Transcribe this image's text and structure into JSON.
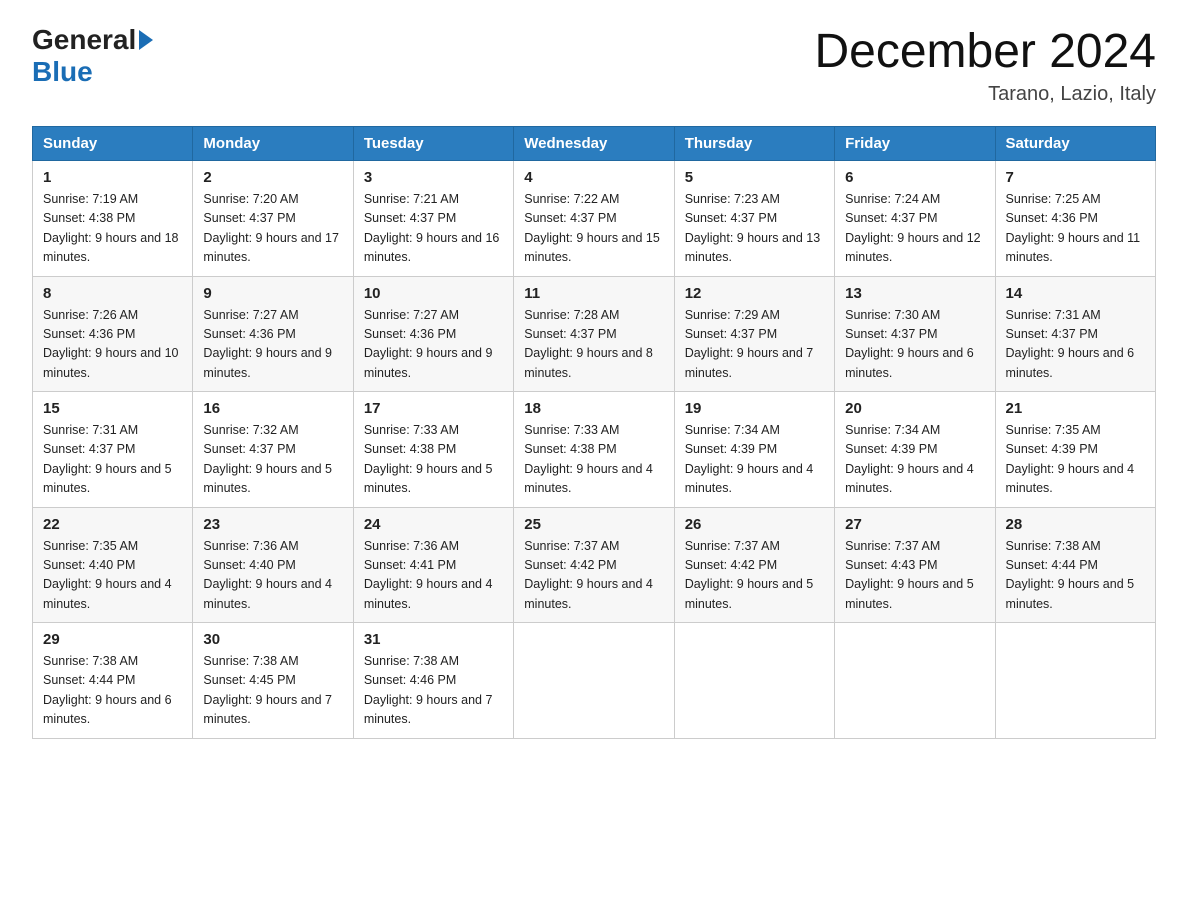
{
  "header": {
    "logo_general": "General",
    "logo_blue": "Blue",
    "title": "December 2024",
    "location": "Tarano, Lazio, Italy"
  },
  "days_of_week": [
    "Sunday",
    "Monday",
    "Tuesday",
    "Wednesday",
    "Thursday",
    "Friday",
    "Saturday"
  ],
  "weeks": [
    [
      {
        "day": "1",
        "sunrise": "7:19 AM",
        "sunset": "4:38 PM",
        "daylight": "9 hours and 18 minutes."
      },
      {
        "day": "2",
        "sunrise": "7:20 AM",
        "sunset": "4:37 PM",
        "daylight": "9 hours and 17 minutes."
      },
      {
        "day": "3",
        "sunrise": "7:21 AM",
        "sunset": "4:37 PM",
        "daylight": "9 hours and 16 minutes."
      },
      {
        "day": "4",
        "sunrise": "7:22 AM",
        "sunset": "4:37 PM",
        "daylight": "9 hours and 15 minutes."
      },
      {
        "day": "5",
        "sunrise": "7:23 AM",
        "sunset": "4:37 PM",
        "daylight": "9 hours and 13 minutes."
      },
      {
        "day": "6",
        "sunrise": "7:24 AM",
        "sunset": "4:37 PM",
        "daylight": "9 hours and 12 minutes."
      },
      {
        "day": "7",
        "sunrise": "7:25 AM",
        "sunset": "4:36 PM",
        "daylight": "9 hours and 11 minutes."
      }
    ],
    [
      {
        "day": "8",
        "sunrise": "7:26 AM",
        "sunset": "4:36 PM",
        "daylight": "9 hours and 10 minutes."
      },
      {
        "day": "9",
        "sunrise": "7:27 AM",
        "sunset": "4:36 PM",
        "daylight": "9 hours and 9 minutes."
      },
      {
        "day": "10",
        "sunrise": "7:27 AM",
        "sunset": "4:36 PM",
        "daylight": "9 hours and 9 minutes."
      },
      {
        "day": "11",
        "sunrise": "7:28 AM",
        "sunset": "4:37 PM",
        "daylight": "9 hours and 8 minutes."
      },
      {
        "day": "12",
        "sunrise": "7:29 AM",
        "sunset": "4:37 PM",
        "daylight": "9 hours and 7 minutes."
      },
      {
        "day": "13",
        "sunrise": "7:30 AM",
        "sunset": "4:37 PM",
        "daylight": "9 hours and 6 minutes."
      },
      {
        "day": "14",
        "sunrise": "7:31 AM",
        "sunset": "4:37 PM",
        "daylight": "9 hours and 6 minutes."
      }
    ],
    [
      {
        "day": "15",
        "sunrise": "7:31 AM",
        "sunset": "4:37 PM",
        "daylight": "9 hours and 5 minutes."
      },
      {
        "day": "16",
        "sunrise": "7:32 AM",
        "sunset": "4:37 PM",
        "daylight": "9 hours and 5 minutes."
      },
      {
        "day": "17",
        "sunrise": "7:33 AM",
        "sunset": "4:38 PM",
        "daylight": "9 hours and 5 minutes."
      },
      {
        "day": "18",
        "sunrise": "7:33 AM",
        "sunset": "4:38 PM",
        "daylight": "9 hours and 4 minutes."
      },
      {
        "day": "19",
        "sunrise": "7:34 AM",
        "sunset": "4:39 PM",
        "daylight": "9 hours and 4 minutes."
      },
      {
        "day": "20",
        "sunrise": "7:34 AM",
        "sunset": "4:39 PM",
        "daylight": "9 hours and 4 minutes."
      },
      {
        "day": "21",
        "sunrise": "7:35 AM",
        "sunset": "4:39 PM",
        "daylight": "9 hours and 4 minutes."
      }
    ],
    [
      {
        "day": "22",
        "sunrise": "7:35 AM",
        "sunset": "4:40 PM",
        "daylight": "9 hours and 4 minutes."
      },
      {
        "day": "23",
        "sunrise": "7:36 AM",
        "sunset": "4:40 PM",
        "daylight": "9 hours and 4 minutes."
      },
      {
        "day": "24",
        "sunrise": "7:36 AM",
        "sunset": "4:41 PM",
        "daylight": "9 hours and 4 minutes."
      },
      {
        "day": "25",
        "sunrise": "7:37 AM",
        "sunset": "4:42 PM",
        "daylight": "9 hours and 4 minutes."
      },
      {
        "day": "26",
        "sunrise": "7:37 AM",
        "sunset": "4:42 PM",
        "daylight": "9 hours and 5 minutes."
      },
      {
        "day": "27",
        "sunrise": "7:37 AM",
        "sunset": "4:43 PM",
        "daylight": "9 hours and 5 minutes."
      },
      {
        "day": "28",
        "sunrise": "7:38 AM",
        "sunset": "4:44 PM",
        "daylight": "9 hours and 5 minutes."
      }
    ],
    [
      {
        "day": "29",
        "sunrise": "7:38 AM",
        "sunset": "4:44 PM",
        "daylight": "9 hours and 6 minutes."
      },
      {
        "day": "30",
        "sunrise": "7:38 AM",
        "sunset": "4:45 PM",
        "daylight": "9 hours and 7 minutes."
      },
      {
        "day": "31",
        "sunrise": "7:38 AM",
        "sunset": "4:46 PM",
        "daylight": "9 hours and 7 minutes."
      },
      null,
      null,
      null,
      null
    ]
  ]
}
